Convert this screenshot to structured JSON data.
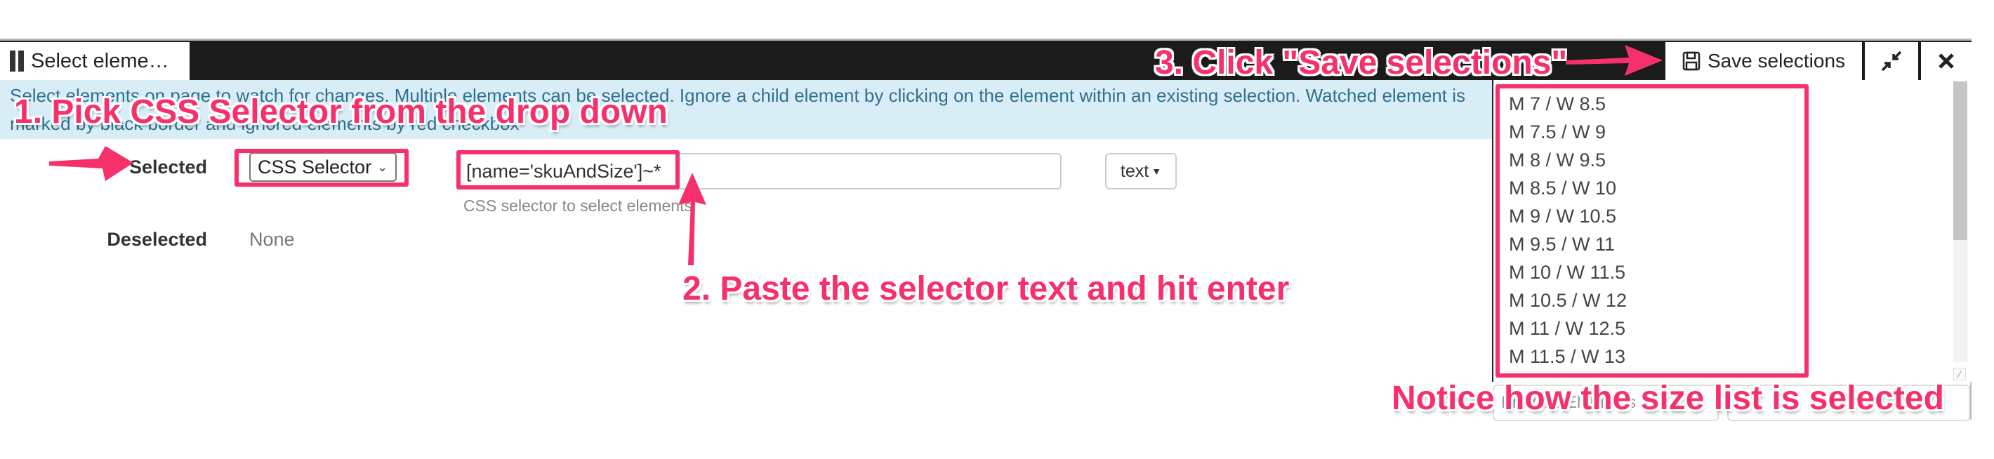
{
  "panel": {
    "tab_title": "Select eleme…",
    "header_buttons": {
      "save_label": "Save selections",
      "save_icon": "floppy-disk-icon",
      "compress_icon": "compress-icon",
      "close_icon": "close-icon"
    },
    "info_text": "Select elements on page to watch for changes. Multiple elements can be selected. Ignore a child element by clicking on the element within an existing selection. Watched element is marked by black border and ignored elements by red checkbox"
  },
  "form": {
    "selected_label": "Selected",
    "selector_type": "CSS Selector",
    "selector_value": "[name='skuAndSize']~*",
    "selector_help": "CSS selector to select elements",
    "extract_mode": "text",
    "deselected_label": "Deselected",
    "deselected_value": "None"
  },
  "preview": {
    "sizes": [
      "M 7 / W 8.5",
      "M 7.5 / W 9",
      "M 8 / W 9.5",
      "M 8.5 / W 10",
      "M 9 / W 10.5",
      "M 9.5 / W 11",
      "M 10 / W 11.5",
      "M 10.5 / W 12",
      "M 11 / W 12.5",
      "M 11.5 / W 13"
    ],
    "bottom_input_1": "Preview Elements",
    "bottom_input_2": ""
  },
  "annotations": {
    "step1": "1. Pick CSS Selector from the drop down",
    "step2": "2. Paste the selector text and hit enter",
    "step3": "3. Click \"Save selections\"",
    "note": "Notice how the size list is selected",
    "color": "#f5306b"
  }
}
